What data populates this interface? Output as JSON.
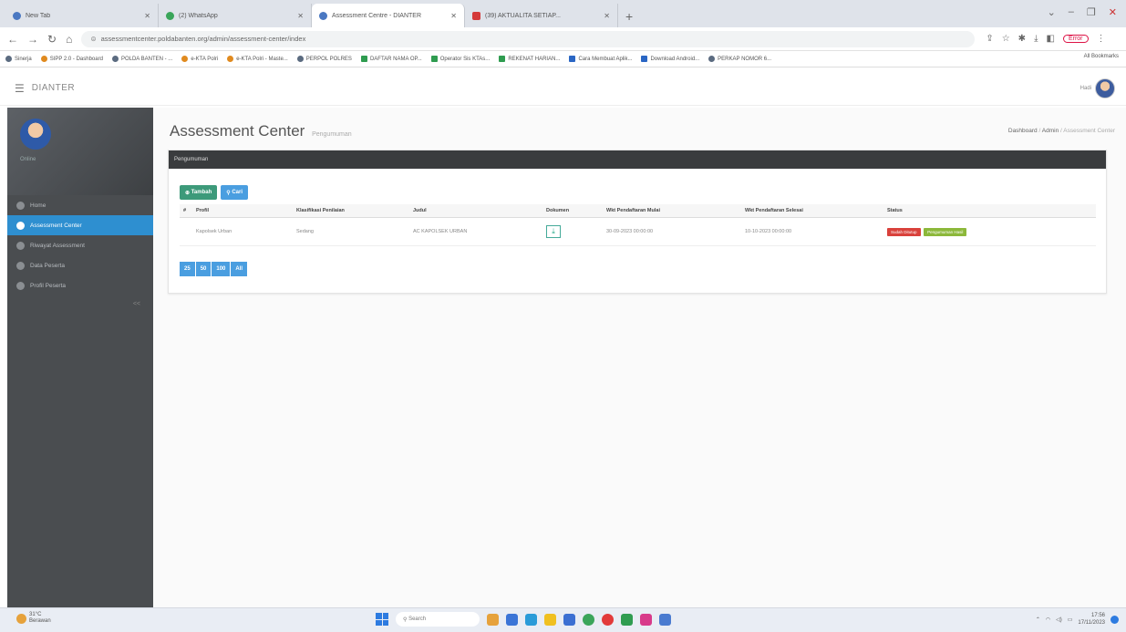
{
  "browser": {
    "tabs": [
      {
        "label": "New Tab",
        "icon": "chrome-tab-icon",
        "active": false
      },
      {
        "label": "(2) WhatsApp",
        "icon": "whatsapp-icon",
        "active": false
      },
      {
        "label": "Assessment Centre - DIANTER",
        "icon": "globe-icon",
        "active": true
      },
      {
        "label": "(39) AKTUALITA SETIAP...",
        "icon": "youtube-icon",
        "active": false
      }
    ],
    "url": "assessmentcenter.poldabanten.org/admin/assessment-center/index",
    "profile_label": "Error",
    "bookmarks": [
      "Sinerja",
      "SIPP 2.0 - Dashboard",
      "POLDA BANTEN - ...",
      "e-KTA Polri",
      "e-KTA Polri - Maste...",
      "PERPOL POLRES",
      "DAFTAR NAMA OP...",
      "Operator Sis KTAs...",
      "REKENAT HARIAN...",
      "Cara Membuat Aplik...",
      "Download Android...",
      "PERKAP NOMOR 6..."
    ],
    "all_bookmarks": "All Bookmarks"
  },
  "app": {
    "brand": "DIANTER",
    "user_name": "Hadi"
  },
  "sidebar": {
    "status": "Online",
    "items": [
      {
        "label": "Home",
        "icon": "home-icon",
        "active": false
      },
      {
        "label": "Assessment Center",
        "icon": "check-circle-icon",
        "active": true
      },
      {
        "label": "Riwayat Assessment",
        "icon": "history-icon",
        "active": false
      },
      {
        "label": "Data Peserta",
        "icon": "users-icon",
        "active": false
      },
      {
        "label": "Profil Peserta",
        "icon": "profile-icon",
        "active": false
      }
    ],
    "collapse": "<<"
  },
  "page": {
    "title": "Assessment Center",
    "subtitle": "Pengumuman",
    "breadcrumb": [
      "Dashboard",
      "Admin",
      "Assessment Center"
    ]
  },
  "card": {
    "header": "Pengumuman",
    "add_button": "Tambah",
    "search_button": "Cari",
    "columns": [
      "#",
      "Profil",
      "Klasifikasi Penilaian",
      "Judul",
      "Dokumen",
      "Wkt Pendaftaran Mulai",
      "Wkt Pendaftaran Selesai",
      "Status"
    ],
    "rows": [
      {
        "num": "",
        "profil": "Kapolsek Urban",
        "klasifikasi": "Sedang",
        "judul": "AC KAPOLSEK URBAN",
        "dokumen": "download-icon",
        "mulai": "30-09-2023 00:00:00",
        "selesai": "10-10-2023 00:00:00",
        "status": [
          "Sudah Ditutup",
          "Pengumuman Hasil"
        ]
      }
    ],
    "page_sizes": [
      "25",
      "50",
      "100",
      "All"
    ]
  },
  "taskbar": {
    "temperature": "31°C",
    "weather": "Berawan",
    "search_placeholder": "Search",
    "time": "17:56",
    "date": "17/11/2023"
  }
}
